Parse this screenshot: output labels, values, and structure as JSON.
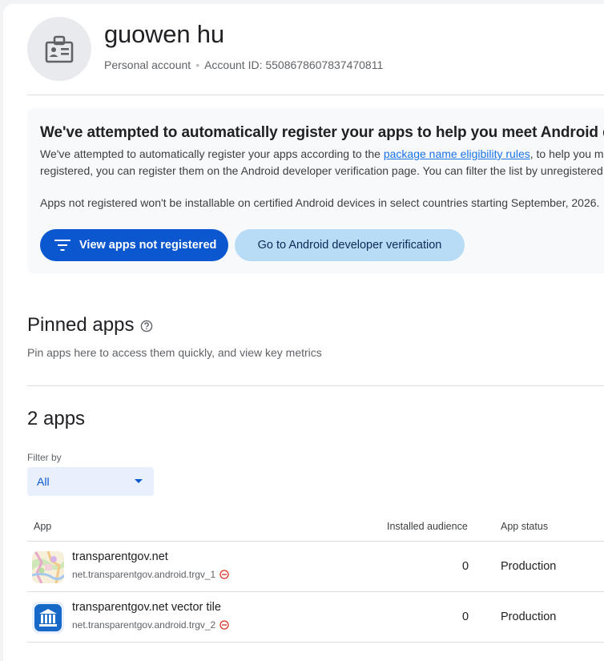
{
  "account": {
    "name": "guowen hu",
    "type": "Personal account",
    "separator": "•",
    "id_label": "Account ID: 5508678607837470811",
    "avatar_icon": "badge-icon"
  },
  "banner": {
    "title": "We've attempted to automatically register your apps to help you meet Android developer verification requirements",
    "line1_pre": "We've attempted to automatically register your apps according to the ",
    "line1_link": "package name eligibility rules",
    "line1_post": ", to help you meet requirements. If your apps weren't",
    "line2": "registered, you can register them on the Android developer verification page. You can filter the list by unregistered apps.",
    "line3": "Apps not registered won't be installable on certified Android devices in select countries starting September, 2026.",
    "primary_button": "View apps not registered",
    "secondary_button": "Go to Android developer verification",
    "primary_icon": "filter-icon"
  },
  "pinned": {
    "title": "Pinned apps",
    "subtitle": "Pin apps here to access them quickly, and view key metrics",
    "help_icon": "help-icon"
  },
  "apps_section": {
    "title": "2 apps",
    "filter_label": "Filter by",
    "filter_value": "All"
  },
  "table": {
    "headers": {
      "app": "App",
      "installed_audience": "Installed audience",
      "app_status": "App status"
    },
    "rows": [
      {
        "name": "transparentgov.net",
        "package": "net.transparentgov.android.trgv_1",
        "installed_audience": "0",
        "status": "Production",
        "icon": "map-app-icon"
      },
      {
        "name": "transparentgov.net vector tile",
        "package": "net.transparentgov.android.trgv_2",
        "installed_audience": "0",
        "status": "Production",
        "icon": "government-building-app-icon"
      }
    ]
  },
  "colors": {
    "primary": "#0b57d0",
    "secondary_button_bg": "#b8dbf6",
    "banner_bg": "#f8f9fa",
    "warning_red": "#d93025"
  }
}
